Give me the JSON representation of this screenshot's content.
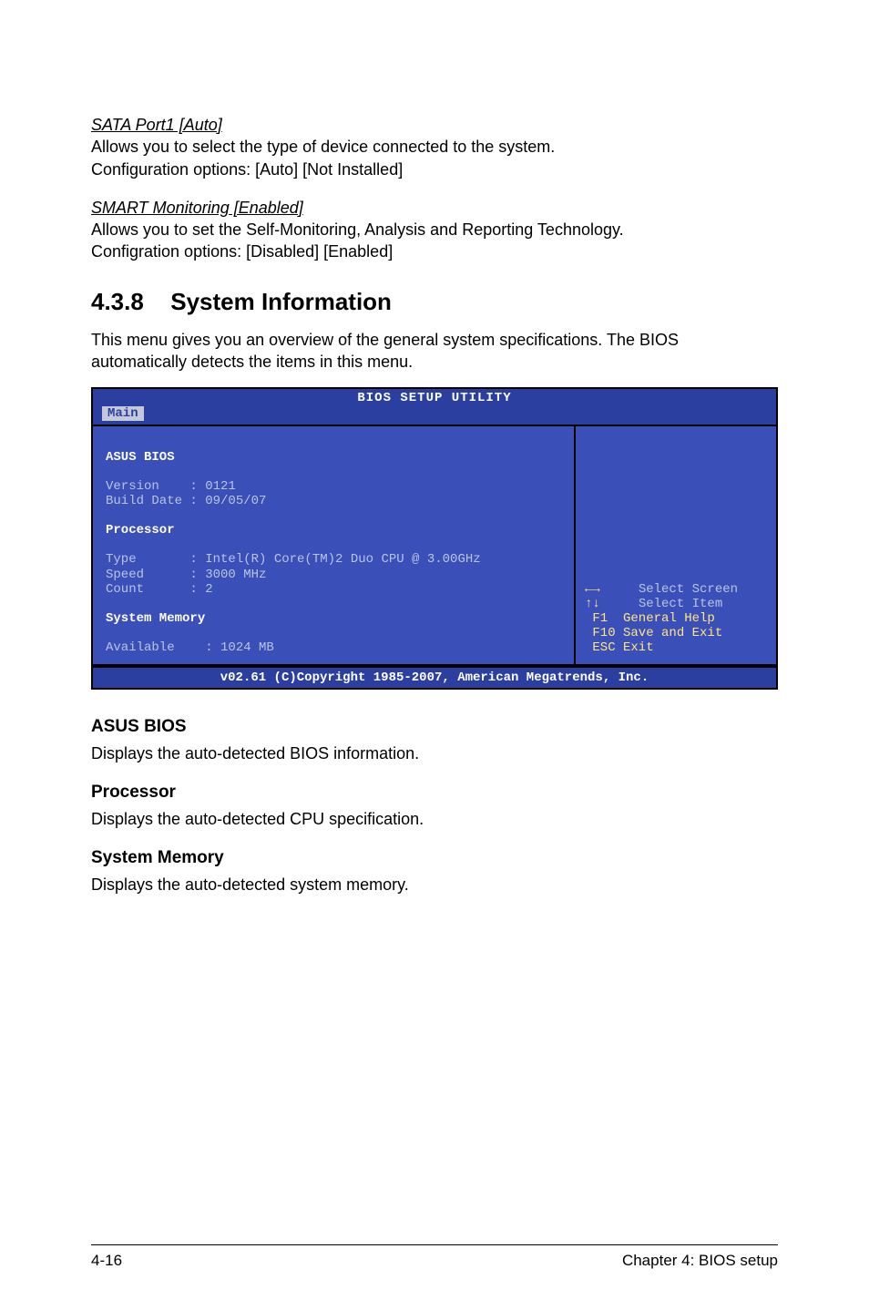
{
  "sata": {
    "heading": "SATA Port1 [Auto]",
    "line1": "Allows you to select the type of device connected to the system.",
    "line2": "Configuration options: [Auto] [Not Installed]"
  },
  "smart": {
    "heading": "SMART Monitoring [Enabled]",
    "line1": "Allows you to set the Self-Monitoring, Analysis and Reporting Technology.",
    "line2": "Configration options: [Disabled] [Enabled]"
  },
  "section": {
    "num": "4.3.8",
    "title": "System Information",
    "intro": "This menu gives you an overview of the general system specifications. The BIOS automatically detects the items in this menu."
  },
  "bios": {
    "title": "BIOS SETUP UTILITY",
    "tab": "Main",
    "left": {
      "h1": "ASUS BIOS",
      "version": "Version    : 0121",
      "builddate": "Build Date : 09/05/07",
      "h2": "Processor",
      "type": "Type       : Intel(R) Core(TM)2 Duo CPU @ 3.00GHz",
      "speed": "Speed      : 3000 MHz",
      "count": "Count      : 2",
      "h3": "System Memory",
      "avail": "Available    : 1024 MB"
    },
    "help": {
      "l1": "     Select Screen",
      "l2": "     Select Item",
      "l3": " F1  General Help",
      "l4": " F10 Save and Exit",
      "l5": " ESC Exit"
    },
    "footer": "v02.61 (C)Copyright 1985-2007, American Megatrends, Inc."
  },
  "subs": {
    "asus_h": "ASUS BIOS",
    "asus_d": "Displays the auto-detected BIOS information.",
    "proc_h": "Processor",
    "proc_d": "Displays the auto-detected CPU specification.",
    "mem_h": "System Memory",
    "mem_d": "Displays the auto-detected system memory."
  },
  "footer": {
    "left": "4-16",
    "right": "Chapter 4: BIOS setup"
  }
}
